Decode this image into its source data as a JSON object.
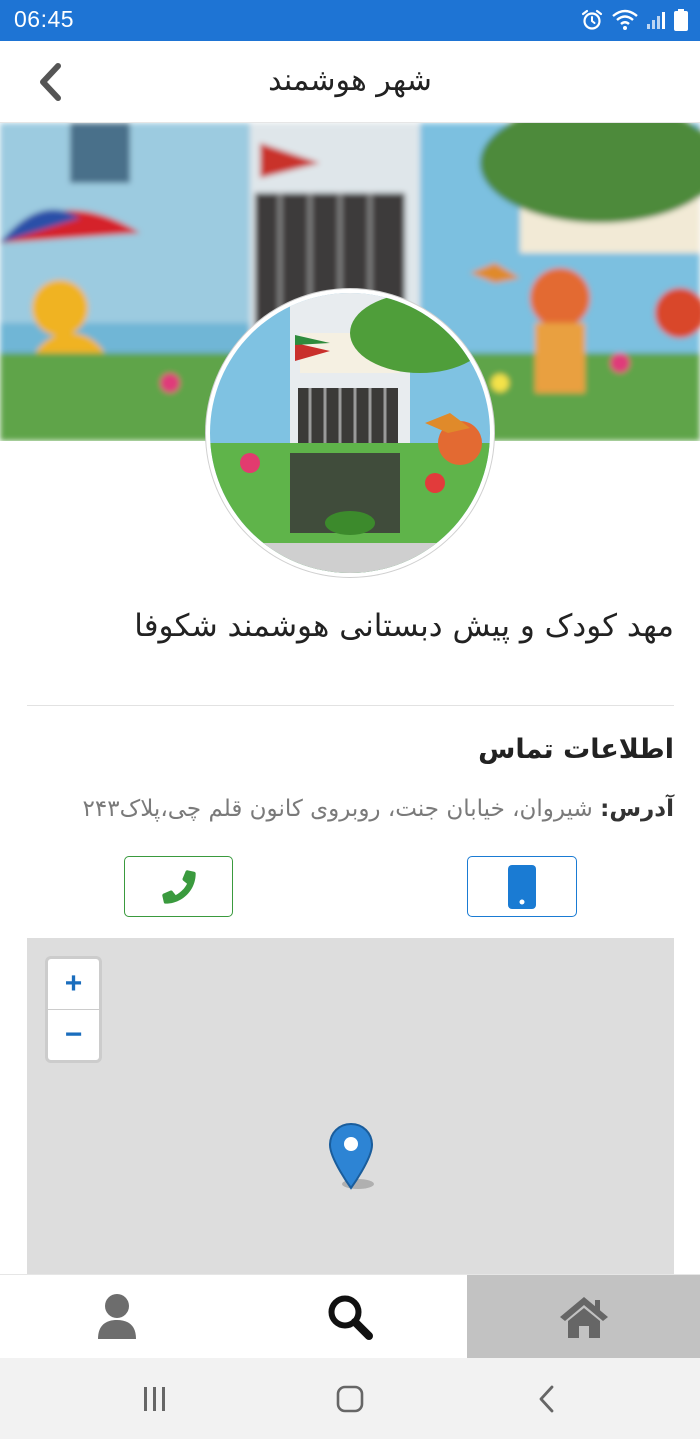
{
  "status_bar": {
    "time": "06:45",
    "icons": [
      "alarm-icon",
      "wifi-icon",
      "signal-icon",
      "battery-icon"
    ],
    "color": "#1e74d4"
  },
  "app_bar": {
    "title": "شهر هوشمند",
    "back_icon": "chevron-left-icon"
  },
  "profile": {
    "name": "مهد کودک و پیش دبستانی هوشمند شکوفا"
  },
  "contact": {
    "heading": "اطلاعات تماس",
    "address_label": "آدرس:",
    "address_value": "شیروان، خیابان جنت، روبروی کانون قلم چی،پلاک۲۴۳",
    "mobile_icon": "mobile-phone-icon",
    "phone_icon": "phone-icon",
    "mobile_color": "#1a7bd3",
    "phone_color": "#3a9a3e"
  },
  "map": {
    "zoom_in": "+",
    "zoom_out": "−",
    "marker_icon": "map-marker-icon"
  },
  "bottom_nav": {
    "items": [
      "profile-icon",
      "search-icon",
      "home-icon"
    ],
    "active": "home"
  },
  "system_nav": [
    "recent-apps-icon",
    "home-button-icon",
    "back-icon"
  ]
}
